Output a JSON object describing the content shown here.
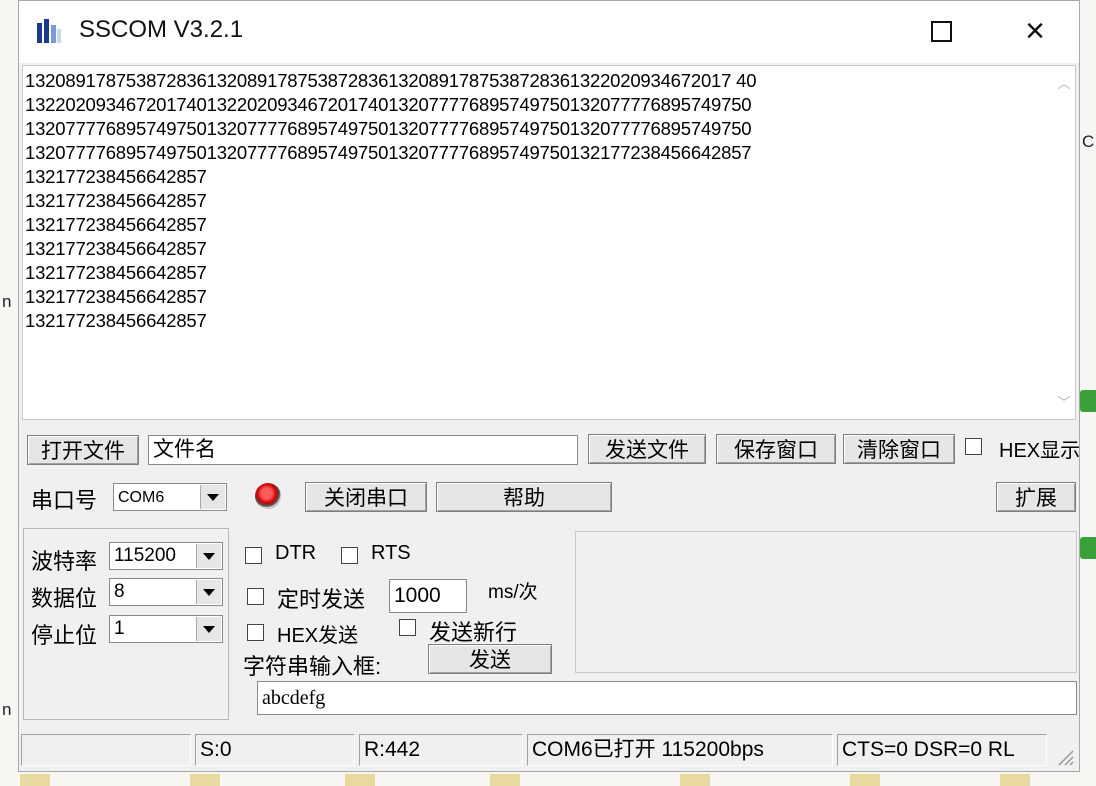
{
  "window": {
    "title": "SSCOM V3.2.1",
    "icon": "sscom-app-icon",
    "controls": {
      "maximize": "maximize-icon",
      "close": "×"
    }
  },
  "receive": {
    "lines": [
      "1320891787538728361320891787538728361320891787538728361322020934672017 40",
      "132202093467201740132202093467201740132077776895749750132077776895749750",
      "132077776895749750132077776895749750132077776895749750132077776895749750",
      "132077776895749750132077776895749750132077776895749750132177238456642857",
      "132177238456642857",
      "132177238456642857",
      "132177238456642857",
      "132177238456642857",
      "132177238456642857",
      "132177238456642857",
      "132177238456642857"
    ]
  },
  "toolbar": {
    "open_file": "打开文件",
    "filename_value": "文件名",
    "send_file": "发送文件",
    "save_window": "保存窗口",
    "clear_window": "清除窗口",
    "hex_display": "HEX显示",
    "port_label": "串口号",
    "port_value": "COM6",
    "close_port": "关闭串口",
    "help": "帮助",
    "expand": "扩展"
  },
  "settings": {
    "baud_label": "波特率",
    "baud_value": "115200",
    "databits_label": "数据位",
    "databits_value": "8",
    "stopbits_label": "停止位",
    "stopbits_value": "1",
    "dtr": "DTR",
    "rts": "RTS",
    "timed_send": "定时发送",
    "interval_value": "1000",
    "interval_unit": "ms/次",
    "hex_send": "HEX发送",
    "send_newline": "发送新行",
    "input_label": "字符串输入框:",
    "send": "发送",
    "input_value": "abcdefg"
  },
  "status": {
    "sent": "S:0",
    "received": "R:442",
    "port_state": "COM6已打开  115200bps",
    "lines": "CTS=0 DSR=0 RL"
  }
}
